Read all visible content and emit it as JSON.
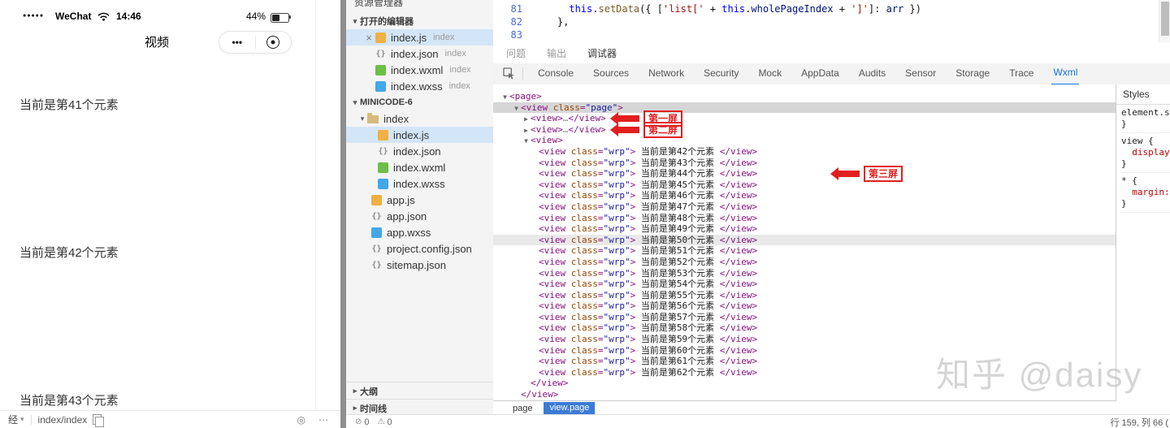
{
  "icons": {
    "chevron_down": "▾",
    "chevron_right": "▸",
    "tree_expanded": "▼",
    "tree_collapsed": "▶",
    "close": "×",
    "menu_dots": "•••",
    "more_menu": "⋯",
    "target_ring": "◎",
    "error_badge": "⊘",
    "warning_badge": "⚠"
  },
  "simulator": {
    "status": {
      "signal_dots": "●●●●●",
      "carrier": "WeChat",
      "time": "14:46",
      "battery_percent": "44%"
    },
    "nav_title": "视频",
    "content_items": [
      "当前是第41个元素",
      "当前是第42个元素",
      "当前是第43个元素"
    ],
    "footer": {
      "mode": "经",
      "route": "index/index"
    }
  },
  "explorer": {
    "title": "资源管理器",
    "open_editors_label": "打开的编辑器",
    "open_editors": [
      {
        "name": "index.js",
        "hint": "index",
        "type": "js",
        "selected": true
      },
      {
        "name": "index.json",
        "hint": "index",
        "type": "json",
        "selected": false
      },
      {
        "name": "index.wxml",
        "hint": "index",
        "type": "wxml",
        "selected": false
      },
      {
        "name": "index.wxss",
        "hint": "index",
        "type": "wxss",
        "selected": false
      }
    ],
    "project_label": "MINICODE-6",
    "folder": {
      "name": "index",
      "files": [
        {
          "name": "index.js",
          "type": "js",
          "selected": true
        },
        {
          "name": "index.json",
          "type": "json",
          "selected": false
        },
        {
          "name": "index.wxml",
          "type": "wxml",
          "selected": false
        },
        {
          "name": "index.wxss",
          "type": "wxss",
          "selected": false
        }
      ]
    },
    "root_files": [
      {
        "name": "app.js",
        "type": "js"
      },
      {
        "name": "app.json",
        "type": "json"
      },
      {
        "name": "app.wxss",
        "type": "wxss"
      },
      {
        "name": "project.config.json",
        "type": "json"
      },
      {
        "name": "sitemap.json",
        "type": "json"
      }
    ],
    "collapsed_sections": [
      "大纲",
      "时间线"
    ]
  },
  "code_editor": {
    "lines": [
      {
        "no": "81",
        "tokens": [
          [
            "      ",
            "p"
          ],
          [
            "this",
            "kw"
          ],
          [
            ".",
            "p"
          ],
          [
            "setData",
            "fn"
          ],
          [
            "({ [",
            "p"
          ],
          [
            "'list['",
            "str"
          ],
          [
            " + ",
            "p"
          ],
          [
            "this",
            "kw"
          ],
          [
            ".",
            "p"
          ],
          [
            "wholePageIndex",
            "var"
          ],
          [
            " + ",
            "p"
          ],
          [
            "']'",
            "str"
          ],
          [
            "]: ",
            "p"
          ],
          [
            "arr",
            "var"
          ],
          [
            " })",
            "p"
          ]
        ]
      },
      {
        "no": "82",
        "tokens": [
          [
            "    ",
            "p"
          ],
          [
            "},",
            "p"
          ]
        ]
      },
      {
        "no": "83",
        "tokens": []
      }
    ]
  },
  "panel_tabs": {
    "items": [
      "问题",
      "输出",
      "调试器"
    ],
    "active": "调试器"
  },
  "devtools_tabs": {
    "items": [
      "Console",
      "Sources",
      "Network",
      "Security",
      "Mock",
      "AppData",
      "Audits",
      "Sensor",
      "Storage",
      "Trace",
      "Wxml"
    ],
    "active": "Wxml"
  },
  "wxml_tree": {
    "root_tag": "page",
    "page_view": {
      "tag": "view",
      "attr_name": "class",
      "attr_value": "page"
    },
    "collapsed_rows": [
      {
        "tag": "view",
        "ellipsis": "…",
        "annotation": "第一屏"
      },
      {
        "tag": "view",
        "ellipsis": "…",
        "annotation": "第二屏"
      }
    ],
    "expanded_tag": "view",
    "child_tag": "view",
    "child_attr_name": "class",
    "child_attr_value": "wrp",
    "children": [
      "当前是第42个元素",
      "当前是第43个元素",
      "当前是第44个元素",
      "当前是第45个元素",
      "当前是第46个元素",
      "当前是第47个元素",
      "当前是第48个元素",
      "当前是第49个元素",
      "当前是第50个元素",
      "当前是第51个元素",
      "当前是第52个元素",
      "当前是第53个元素",
      "当前是第54个元素",
      "当前是第55个元素",
      "当前是第56个元素",
      "当前是第57个元素",
      "当前是第58个元素",
      "当前是第59个元素",
      "当前是第60个元素",
      "当前是第61个元素",
      "当前是第62个元素"
    ],
    "highlighted_index": 8,
    "third_annotation": "第三屏"
  },
  "styles_panel": {
    "title": "Styles",
    "rules": [
      {
        "selector": "element.style",
        "props": []
      },
      {
        "selector": "view",
        "props": [
          {
            "name": "display"
          }
        ]
      },
      {
        "selector": "*",
        "props": [
          {
            "name": "margin"
          }
        ]
      }
    ]
  },
  "breadcrumb": {
    "ancestor": "page",
    "selected": "view.page"
  },
  "status_bar": {
    "error_count": "0",
    "warning_count": "0",
    "cursor_position": "行 159, 列 66 ("
  },
  "watermark": "知乎 @daisy"
}
